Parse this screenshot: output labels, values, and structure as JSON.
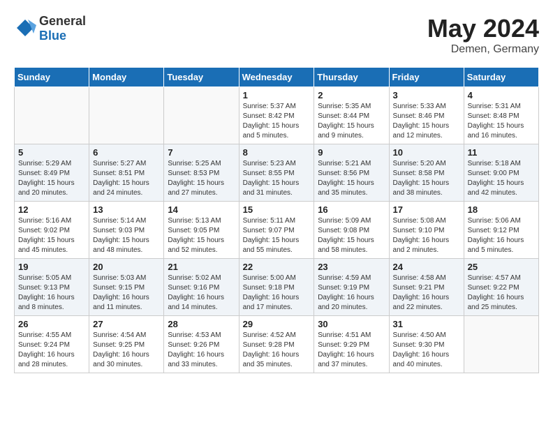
{
  "header": {
    "logo_general": "General",
    "logo_blue": "Blue",
    "title": "May 2024",
    "location": "Demen, Germany"
  },
  "columns": [
    "Sunday",
    "Monday",
    "Tuesday",
    "Wednesday",
    "Thursday",
    "Friday",
    "Saturday"
  ],
  "weeks": [
    [
      {
        "day": "",
        "info": ""
      },
      {
        "day": "",
        "info": ""
      },
      {
        "day": "",
        "info": ""
      },
      {
        "day": "1",
        "info": "Sunrise: 5:37 AM\nSunset: 8:42 PM\nDaylight: 15 hours\nand 5 minutes."
      },
      {
        "day": "2",
        "info": "Sunrise: 5:35 AM\nSunset: 8:44 PM\nDaylight: 15 hours\nand 9 minutes."
      },
      {
        "day": "3",
        "info": "Sunrise: 5:33 AM\nSunset: 8:46 PM\nDaylight: 15 hours\nand 12 minutes."
      },
      {
        "day": "4",
        "info": "Sunrise: 5:31 AM\nSunset: 8:48 PM\nDaylight: 15 hours\nand 16 minutes."
      }
    ],
    [
      {
        "day": "5",
        "info": "Sunrise: 5:29 AM\nSunset: 8:49 PM\nDaylight: 15 hours\nand 20 minutes."
      },
      {
        "day": "6",
        "info": "Sunrise: 5:27 AM\nSunset: 8:51 PM\nDaylight: 15 hours\nand 24 minutes."
      },
      {
        "day": "7",
        "info": "Sunrise: 5:25 AM\nSunset: 8:53 PM\nDaylight: 15 hours\nand 27 minutes."
      },
      {
        "day": "8",
        "info": "Sunrise: 5:23 AM\nSunset: 8:55 PM\nDaylight: 15 hours\nand 31 minutes."
      },
      {
        "day": "9",
        "info": "Sunrise: 5:21 AM\nSunset: 8:56 PM\nDaylight: 15 hours\nand 35 minutes."
      },
      {
        "day": "10",
        "info": "Sunrise: 5:20 AM\nSunset: 8:58 PM\nDaylight: 15 hours\nand 38 minutes."
      },
      {
        "day": "11",
        "info": "Sunrise: 5:18 AM\nSunset: 9:00 PM\nDaylight: 15 hours\nand 42 minutes."
      }
    ],
    [
      {
        "day": "12",
        "info": "Sunrise: 5:16 AM\nSunset: 9:02 PM\nDaylight: 15 hours\nand 45 minutes."
      },
      {
        "day": "13",
        "info": "Sunrise: 5:14 AM\nSunset: 9:03 PM\nDaylight: 15 hours\nand 48 minutes."
      },
      {
        "day": "14",
        "info": "Sunrise: 5:13 AM\nSunset: 9:05 PM\nDaylight: 15 hours\nand 52 minutes."
      },
      {
        "day": "15",
        "info": "Sunrise: 5:11 AM\nSunset: 9:07 PM\nDaylight: 15 hours\nand 55 minutes."
      },
      {
        "day": "16",
        "info": "Sunrise: 5:09 AM\nSunset: 9:08 PM\nDaylight: 15 hours\nand 58 minutes."
      },
      {
        "day": "17",
        "info": "Sunrise: 5:08 AM\nSunset: 9:10 PM\nDaylight: 16 hours\nand 2 minutes."
      },
      {
        "day": "18",
        "info": "Sunrise: 5:06 AM\nSunset: 9:12 PM\nDaylight: 16 hours\nand 5 minutes."
      }
    ],
    [
      {
        "day": "19",
        "info": "Sunrise: 5:05 AM\nSunset: 9:13 PM\nDaylight: 16 hours\nand 8 minutes."
      },
      {
        "day": "20",
        "info": "Sunrise: 5:03 AM\nSunset: 9:15 PM\nDaylight: 16 hours\nand 11 minutes."
      },
      {
        "day": "21",
        "info": "Sunrise: 5:02 AM\nSunset: 9:16 PM\nDaylight: 16 hours\nand 14 minutes."
      },
      {
        "day": "22",
        "info": "Sunrise: 5:00 AM\nSunset: 9:18 PM\nDaylight: 16 hours\nand 17 minutes."
      },
      {
        "day": "23",
        "info": "Sunrise: 4:59 AM\nSunset: 9:19 PM\nDaylight: 16 hours\nand 20 minutes."
      },
      {
        "day": "24",
        "info": "Sunrise: 4:58 AM\nSunset: 9:21 PM\nDaylight: 16 hours\nand 22 minutes."
      },
      {
        "day": "25",
        "info": "Sunrise: 4:57 AM\nSunset: 9:22 PM\nDaylight: 16 hours\nand 25 minutes."
      }
    ],
    [
      {
        "day": "26",
        "info": "Sunrise: 4:55 AM\nSunset: 9:24 PM\nDaylight: 16 hours\nand 28 minutes."
      },
      {
        "day": "27",
        "info": "Sunrise: 4:54 AM\nSunset: 9:25 PM\nDaylight: 16 hours\nand 30 minutes."
      },
      {
        "day": "28",
        "info": "Sunrise: 4:53 AM\nSunset: 9:26 PM\nDaylight: 16 hours\nand 33 minutes."
      },
      {
        "day": "29",
        "info": "Sunrise: 4:52 AM\nSunset: 9:28 PM\nDaylight: 16 hours\nand 35 minutes."
      },
      {
        "day": "30",
        "info": "Sunrise: 4:51 AM\nSunset: 9:29 PM\nDaylight: 16 hours\nand 37 minutes."
      },
      {
        "day": "31",
        "info": "Sunrise: 4:50 AM\nSunset: 9:30 PM\nDaylight: 16 hours\nand 40 minutes."
      },
      {
        "day": "",
        "info": ""
      }
    ]
  ]
}
